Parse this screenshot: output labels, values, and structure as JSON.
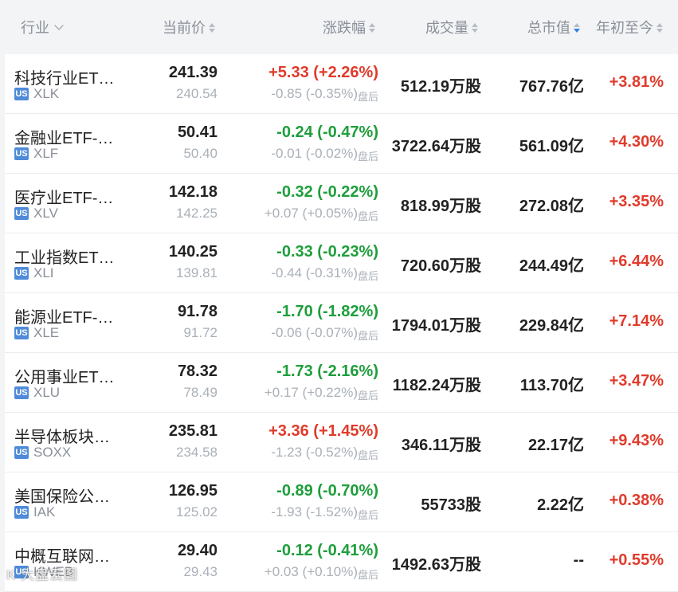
{
  "header": {
    "industry": "行业",
    "price": "当前价",
    "change": "涨跌幅",
    "volume": "成交量",
    "market_cap": "总市值",
    "ytd": "年初至今"
  },
  "market_badge": "US",
  "after_hours_label": "盘后",
  "colors": {
    "up": "#e03b2b",
    "down": "#1e9e3c",
    "accent": "#2f80ed"
  },
  "rows": [
    {
      "name": "科技行业ET…",
      "ticker": "XLK",
      "price": "241.39",
      "prev": "240.54",
      "change": "+5.33 (+2.26%)",
      "direction": "up",
      "ah_change": "-0.85 (-0.35%)",
      "volume": "512.19万股",
      "market_cap": "767.76亿",
      "ytd": "+3.81%"
    },
    {
      "name": "金融业ETF-…",
      "ticker": "XLF",
      "price": "50.41",
      "prev": "50.40",
      "change": "-0.24 (-0.47%)",
      "direction": "down",
      "ah_change": "-0.01 (-0.02%)",
      "volume": "3722.64万股",
      "market_cap": "561.09亿",
      "ytd": "+4.30%"
    },
    {
      "name": "医疗业ETF-…",
      "ticker": "XLV",
      "price": "142.18",
      "prev": "142.25",
      "change": "-0.32 (-0.22%)",
      "direction": "down",
      "ah_change": "+0.07 (+0.05%)",
      "volume": "818.99万股",
      "market_cap": "272.08亿",
      "ytd": "+3.35%"
    },
    {
      "name": "工业指数ET…",
      "ticker": "XLI",
      "price": "140.25",
      "prev": "139.81",
      "change": "-0.33 (-0.23%)",
      "direction": "down",
      "ah_change": "-0.44 (-0.31%)",
      "volume": "720.60万股",
      "market_cap": "244.49亿",
      "ytd": "+6.44%"
    },
    {
      "name": "能源业ETF-…",
      "ticker": "XLE",
      "price": "91.78",
      "prev": "91.72",
      "change": "-1.70 (-1.82%)",
      "direction": "down",
      "ah_change": "-0.06 (-0.07%)",
      "volume": "1794.01万股",
      "market_cap": "229.84亿",
      "ytd": "+7.14%"
    },
    {
      "name": "公用事业ET…",
      "ticker": "XLU",
      "price": "78.32",
      "prev": "78.49",
      "change": "-1.73 (-2.16%)",
      "direction": "down",
      "ah_change": "+0.17 (+0.22%)",
      "volume": "1182.24万股",
      "market_cap": "113.70亿",
      "ytd": "+3.47%"
    },
    {
      "name": "半导体板块…",
      "ticker": "SOXX",
      "price": "235.81",
      "prev": "234.58",
      "change": "+3.36 (+1.45%)",
      "direction": "up",
      "ah_change": "-1.23 (-0.52%)",
      "volume": "346.11万股",
      "market_cap": "22.17亿",
      "ytd": "+9.43%"
    },
    {
      "name": "美国保险公…",
      "ticker": "IAK",
      "price": "126.95",
      "prev": "125.02",
      "change": "-0.89 (-0.70%)",
      "direction": "down",
      "ah_change": "-1.93 (-1.52%)",
      "volume": "55733股",
      "market_cap": "2.22亿",
      "ytd": "+0.38%"
    },
    {
      "name": "中概互联网…",
      "ticker": "KWEB",
      "price": "29.40",
      "prev": "29.43",
      "change": "-0.12 (-0.41%)",
      "direction": "down",
      "ah_change": "+0.03 (+0.10%)",
      "volume": "1492.63万股",
      "market_cap": "--",
      "ytd": "+0.55%"
    }
  ],
  "watermark": "K 大盘云图"
}
